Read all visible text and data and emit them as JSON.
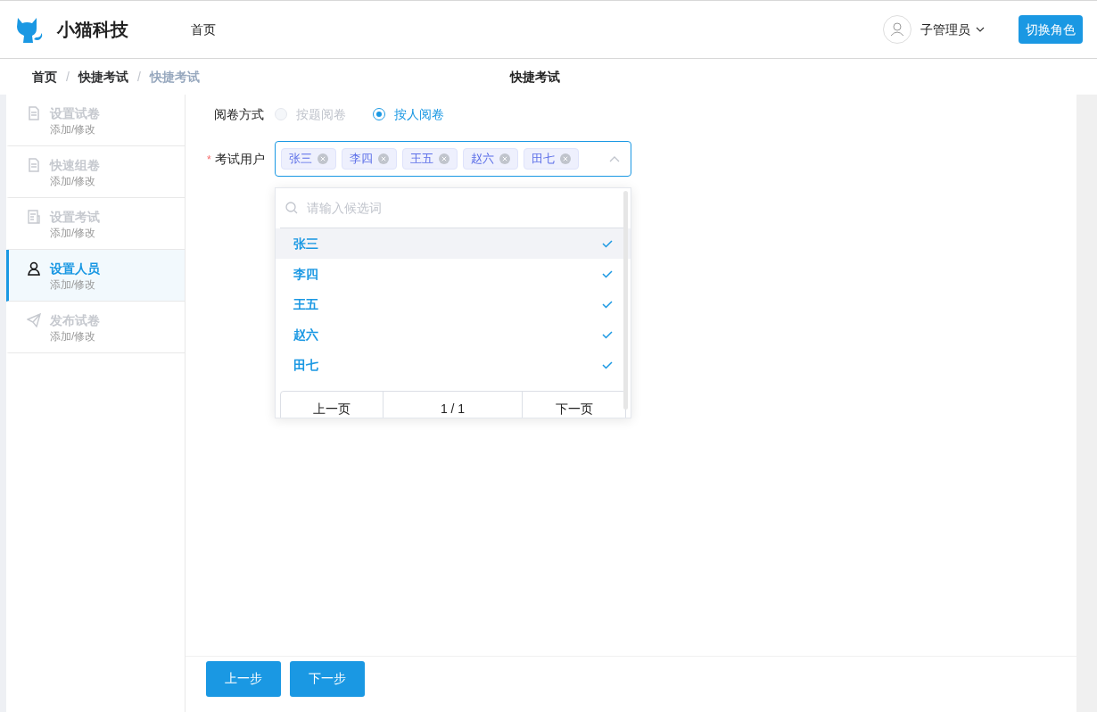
{
  "header": {
    "brand": "小猫科技",
    "nav": [
      "首页"
    ],
    "user": "子管理员",
    "switch_button": "切换角色"
  },
  "breadcrumb": [
    {
      "text": "首页"
    },
    {
      "separator": "/",
      "text": "快捷考试"
    },
    {
      "separator": "/",
      "text": "快捷考试"
    }
  ],
  "page_title": "快捷考试",
  "steps": [
    {
      "kind": "paper",
      "title": "设置试卷",
      "subtitle": "添加/修改",
      "selected": false
    },
    {
      "kind": "paper",
      "title": "快速组卷",
      "subtitle": "添加/修改",
      "selected": false
    },
    {
      "kind": "exam",
      "title": "设置考试",
      "subtitle": "添加/修改",
      "selected": false
    },
    {
      "kind": "person",
      "title": "设置人员",
      "subtitle": "添加/修改",
      "selected": true
    },
    {
      "kind": "send",
      "title": "发布试卷",
      "subtitle": "添加/修改",
      "selected": false
    }
  ],
  "grading": {
    "label": "阅卷方式",
    "options": [
      {
        "label": "按题阅卷",
        "selected": false,
        "disabled": true
      },
      {
        "label": "按人阅卷",
        "selected": true,
        "disabled": false
      }
    ]
  },
  "users": {
    "label": "考试用户",
    "required_mark": "*",
    "tags": [
      "张三",
      "李四",
      "王五",
      "赵六",
      "田七"
    ],
    "dropdown": {
      "search_placeholder": "请输入候选词",
      "options": [
        {
          "label": "张三",
          "selected": true,
          "highlighted": true
        },
        {
          "label": "李四",
          "selected": true,
          "highlighted": false
        },
        {
          "label": "王五",
          "selected": true,
          "highlighted": false
        },
        {
          "label": "赵六",
          "selected": true,
          "highlighted": false
        },
        {
          "label": "田七",
          "selected": true,
          "highlighted": false
        }
      ],
      "pager": {
        "prev": "上一页",
        "page": "1 / 1",
        "next": "下一页"
      }
    }
  },
  "footer_buttons": [
    "上一步",
    "下一步"
  ]
}
